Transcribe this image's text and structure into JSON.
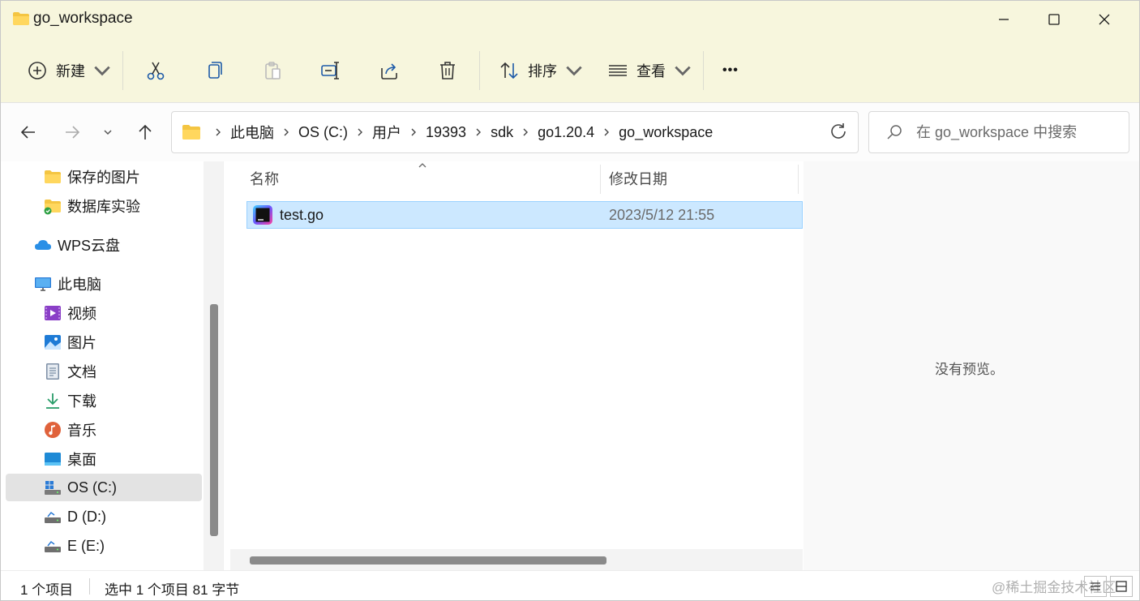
{
  "window": {
    "title": "go_workspace"
  },
  "toolbar": {
    "new_label": "新建",
    "sort_label": "排序",
    "view_label": "查看",
    "more_label": "•••"
  },
  "address": {
    "crumbs": [
      "此电脑",
      "OS (C:)",
      "用户",
      "19393",
      "sdk",
      "go1.20.4",
      "go_workspace"
    ]
  },
  "search": {
    "placeholder": "在 go_workspace 中搜索"
  },
  "sidebar": {
    "items": [
      {
        "label": "保存的图片"
      },
      {
        "label": "数据库实验"
      },
      {
        "label": "WPS云盘"
      },
      {
        "label": "此电脑"
      },
      {
        "label": "视频"
      },
      {
        "label": "图片"
      },
      {
        "label": "文档"
      },
      {
        "label": "下载"
      },
      {
        "label": "音乐"
      },
      {
        "label": "桌面"
      },
      {
        "label": "OS (C:)"
      },
      {
        "label": "D (D:)"
      },
      {
        "label": "E (E:)"
      }
    ]
  },
  "columns": {
    "name": "名称",
    "modified": "修改日期"
  },
  "files": [
    {
      "name": "test.go",
      "modified": "2023/5/12 21:55"
    }
  ],
  "preview": {
    "text": "没有预览。"
  },
  "status": {
    "count": "1 个项目",
    "selected": "选中 1 个项目  81 字节",
    "watermark": "@稀土掘金技术社区"
  },
  "colors": {
    "accent": "#0067c0",
    "titlebar": "#f7f6dd",
    "selection": "#cce8ff"
  }
}
